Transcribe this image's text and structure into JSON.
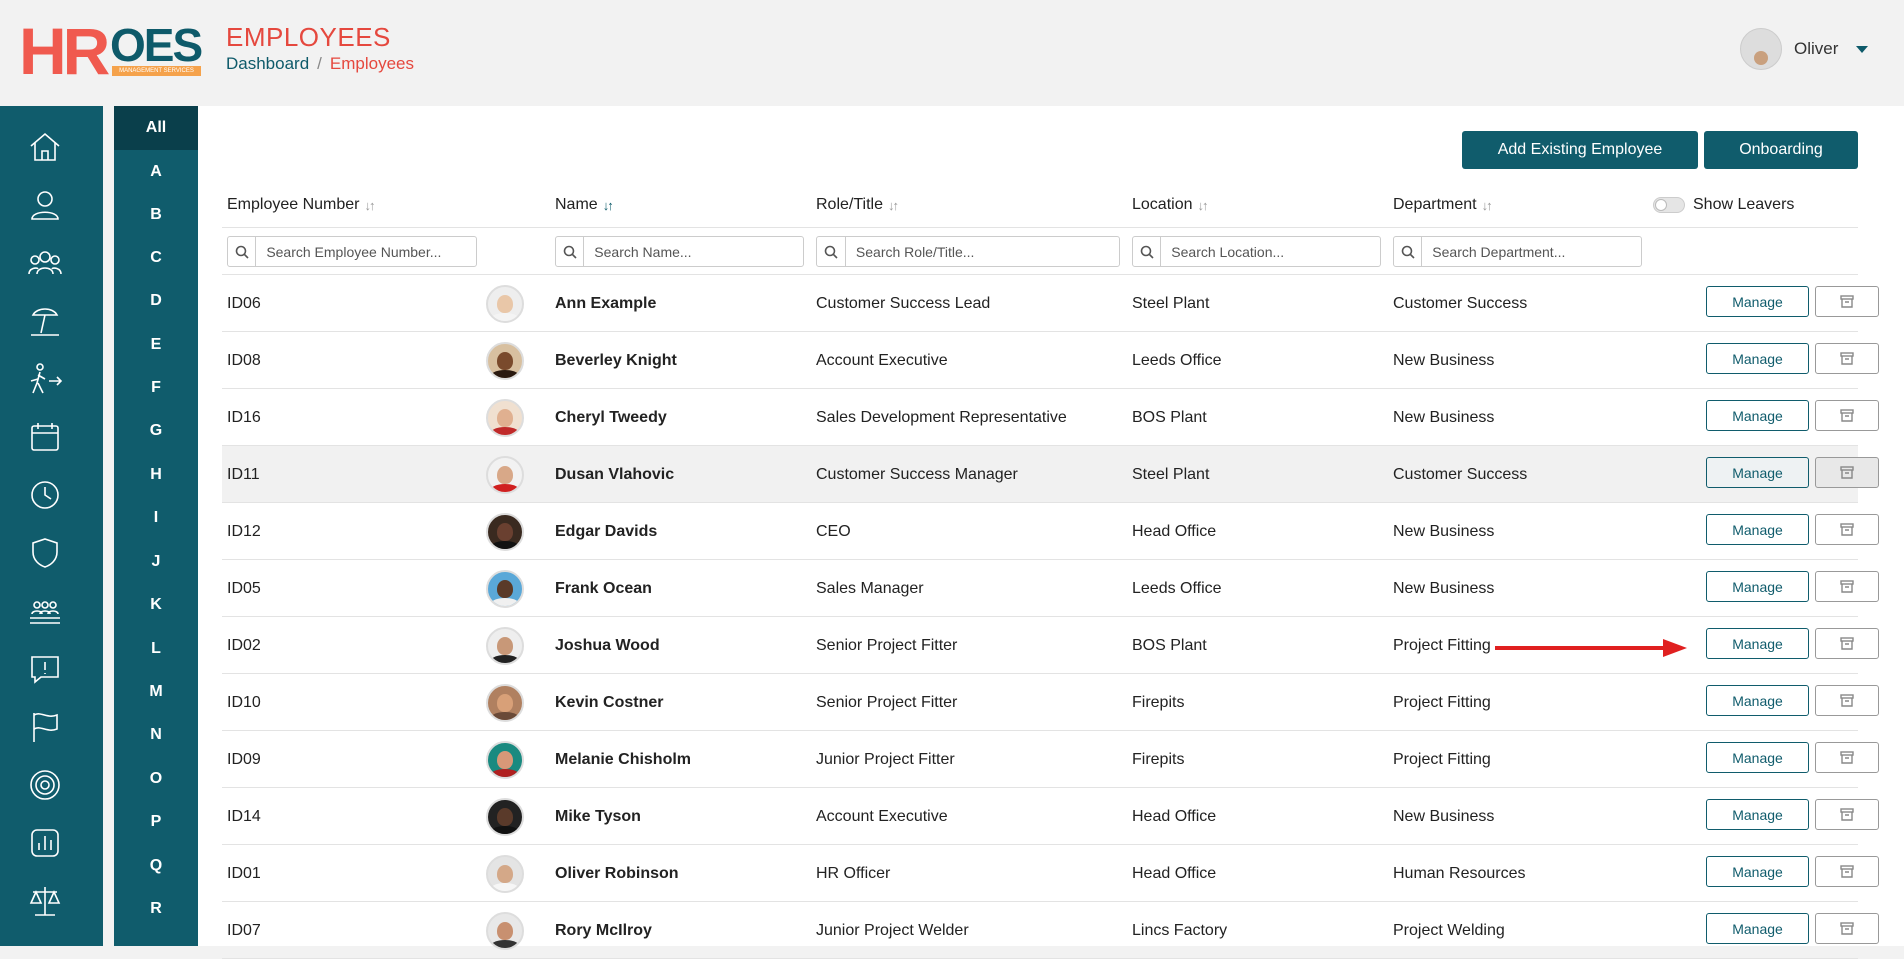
{
  "header": {
    "logo_hr": "HR",
    "logo_oes": "OES",
    "logo_sub": "MANAGEMENT SERVICES",
    "title": "EMPLOYEES",
    "breadcrumb": {
      "home": "Dashboard",
      "sep": "/",
      "current": "Employees"
    },
    "user_name": "Oliver"
  },
  "sidenav": {
    "icons": [
      "home-icon",
      "user-icon",
      "users-icon",
      "holiday-icon",
      "walk-arrow-icon",
      "calendar-icon",
      "clock-icon",
      "shield-icon",
      "team-icon",
      "alert-chat-icon",
      "flag-icon",
      "target-icon",
      "chart-icon",
      "scales-icon"
    ]
  },
  "alpha": {
    "letters": [
      "All",
      "A",
      "B",
      "C",
      "D",
      "E",
      "F",
      "G",
      "H",
      "I",
      "J",
      "K",
      "L",
      "M",
      "N",
      "O",
      "P",
      "Q",
      "R"
    ],
    "active": "All"
  },
  "actions": {
    "add_existing": "Add Existing Employee",
    "onboarding": "Onboarding"
  },
  "table": {
    "columns": {
      "number": "Employee Number",
      "name": "Name",
      "role": "Role/Title",
      "location": "Location",
      "department": "Department"
    },
    "show_leavers": "Show Leavers",
    "placeholders": {
      "number": "Search Employee Number...",
      "name": "Search Name...",
      "role": "Search Role/Title...",
      "location": "Search Location...",
      "department": "Search Department..."
    },
    "manage_label": "Manage",
    "rows": [
      {
        "id": "ID06",
        "name": "Ann Example",
        "role": "Customer Success Lead",
        "location": "Steel Plant",
        "department": "Customer Success"
      },
      {
        "id": "ID08",
        "name": "Beverley Knight",
        "role": "Account Executive",
        "location": "Leeds Office",
        "department": "New Business"
      },
      {
        "id": "ID16",
        "name": "Cheryl Tweedy",
        "role": "Sales Development Representative",
        "location": "BOS Plant",
        "department": "New Business"
      },
      {
        "id": "ID11",
        "name": "Dusan Vlahovic",
        "role": "Customer Success Manager",
        "location": "Steel Plant",
        "department": "Customer Success"
      },
      {
        "id": "ID12",
        "name": "Edgar Davids",
        "role": "CEO",
        "location": "Head Office",
        "department": "New Business"
      },
      {
        "id": "ID05",
        "name": "Frank Ocean",
        "role": "Sales Manager",
        "location": "Leeds Office",
        "department": "New Business"
      },
      {
        "id": "ID02",
        "name": "Joshua Wood",
        "role": "Senior Project Fitter",
        "location": "BOS Plant",
        "department": "Project Fitting"
      },
      {
        "id": "ID10",
        "name": "Kevin Costner",
        "role": "Senior Project Fitter",
        "location": "Firepits",
        "department": "Project Fitting"
      },
      {
        "id": "ID09",
        "name": "Melanie Chisholm",
        "role": "Junior Project Fitter",
        "location": "Firepits",
        "department": "Project Fitting"
      },
      {
        "id": "ID14",
        "name": "Mike Tyson",
        "role": "Account Executive",
        "location": "Head Office",
        "department": "New Business"
      },
      {
        "id": "ID01",
        "name": "Oliver Robinson",
        "role": "HR Officer",
        "location": "Head Office",
        "department": "Human Resources"
      },
      {
        "id": "ID07",
        "name": "Rory McIlroy",
        "role": "Junior Project Welder",
        "location": "Lincs Factory",
        "department": "Project Welding"
      }
    ]
  },
  "colors": {
    "brand_teal": "#105c6c",
    "brand_red": "#e5483e",
    "arrow_red": "#e02020"
  }
}
